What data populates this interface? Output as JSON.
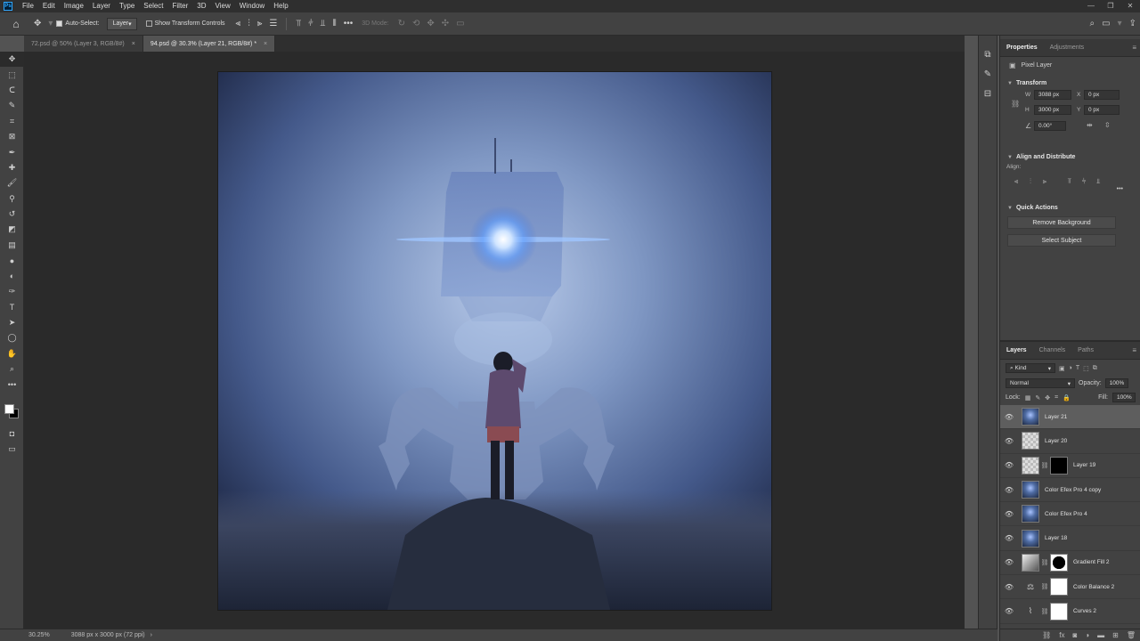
{
  "app": {
    "logo": "Ps",
    "menu": [
      "File",
      "Edit",
      "Image",
      "Layer",
      "Type",
      "Select",
      "Filter",
      "3D",
      "View",
      "Window",
      "Help"
    ],
    "window_controls": [
      "—",
      "❐",
      "✕"
    ]
  },
  "options_bar": {
    "auto_select_label": "Auto-Select:",
    "auto_select_target": "Layer",
    "show_transform_label": "Show Transform Controls",
    "more": "•••",
    "mode_3d_label": "3D Mode:"
  },
  "tabs": [
    {
      "label": "72.psd @ 50% (Layer 3, RGB/8#)",
      "close": "×"
    },
    {
      "label": "94.psd @ 30.3% (Layer 21, RGB/8#) *",
      "close": "×"
    }
  ],
  "status": {
    "zoom": "30.25%",
    "dimensions": "3088 px x 3000 px (72 ppi)",
    "arrow": "›"
  },
  "properties": {
    "tabs": [
      "Properties",
      "Adjustments"
    ],
    "kind": "Pixel Layer",
    "transform": {
      "title": "Transform",
      "w_label": "W",
      "w": "3088 px",
      "h_label": "H",
      "h": "3000 px",
      "x_label": "X",
      "x": "0 px",
      "y_label": "Y",
      "y": "0 px",
      "angle": "0.00°"
    },
    "align": {
      "title": "Align and Distribute",
      "label": "Align:",
      "more": "•••"
    },
    "quick_actions": {
      "title": "Quick Actions",
      "remove_bg": "Remove Background",
      "select_subject": "Select Subject"
    }
  },
  "layers": {
    "tabs": [
      "Layers",
      "Channels",
      "Paths"
    ],
    "filter_kind": "Kind",
    "blend_mode": "Normal",
    "opacity_label": "Opacity:",
    "opacity": "100%",
    "lock_label": "Lock:",
    "fill_label": "Fill:",
    "fill": "100%",
    "items": [
      {
        "name": "Layer 21",
        "thumb": "scene",
        "mask": "",
        "selected": true
      },
      {
        "name": "Layer 20",
        "thumb": "trans",
        "mask": "",
        "selected": false
      },
      {
        "name": "Layer 19",
        "thumb": "trans",
        "mask": "black",
        "selected": false
      },
      {
        "name": "Color Efex Pro 4 copy",
        "thumb": "scene",
        "mask": "",
        "selected": false
      },
      {
        "name": "Color Efex Pro 4",
        "thumb": "scene",
        "mask": "",
        "selected": false
      },
      {
        "name": "Layer 18",
        "thumb": "scene",
        "mask": "",
        "selected": false
      },
      {
        "name": "Gradient Fill 2",
        "thumb": "grad",
        "mask": "circle",
        "selected": false
      },
      {
        "name": "Color Balance 2",
        "thumb": "adj-balance",
        "mask": "white",
        "selected": false
      },
      {
        "name": "Curves 2",
        "thumb": "adj-curves",
        "mask": "white",
        "selected": false
      }
    ]
  },
  "colors": {
    "foreground": "#ffffff",
    "background": "#000000",
    "accent": "#31a8ff"
  }
}
